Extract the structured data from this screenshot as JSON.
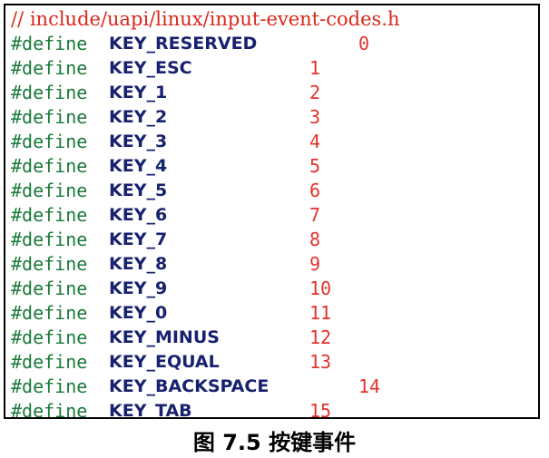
{
  "code": {
    "comment": "// include/uapi/linux/input-event-codes.h",
    "keyword": "#define",
    "defines": [
      {
        "name": "KEY_RESERVED",
        "value": "0"
      },
      {
        "name": "KEY_ESC",
        "value": "1"
      },
      {
        "name": "KEY_1",
        "value": "2"
      },
      {
        "name": "KEY_2",
        "value": "3"
      },
      {
        "name": "KEY_3",
        "value": "4"
      },
      {
        "name": "KEY_4",
        "value": "5"
      },
      {
        "name": "KEY_5",
        "value": "6"
      },
      {
        "name": "KEY_6",
        "value": "7"
      },
      {
        "name": "KEY_7",
        "value": "8"
      },
      {
        "name": "KEY_8",
        "value": "9"
      },
      {
        "name": "KEY_9",
        "value": "10"
      },
      {
        "name": "KEY_0",
        "value": "11"
      },
      {
        "name": "KEY_MINUS",
        "value": "12"
      },
      {
        "name": "KEY_EQUAL",
        "value": "13"
      },
      {
        "name": "KEY_BACKSPACE",
        "value": "14"
      },
      {
        "name": "KEY_TAB",
        "value": "15"
      }
    ]
  },
  "caption": "图 7.5 按键事件",
  "colors": {
    "comment": "#d8281c",
    "keyword": "#1a7a3a",
    "name": "#17226e",
    "value": "#e4322a"
  }
}
